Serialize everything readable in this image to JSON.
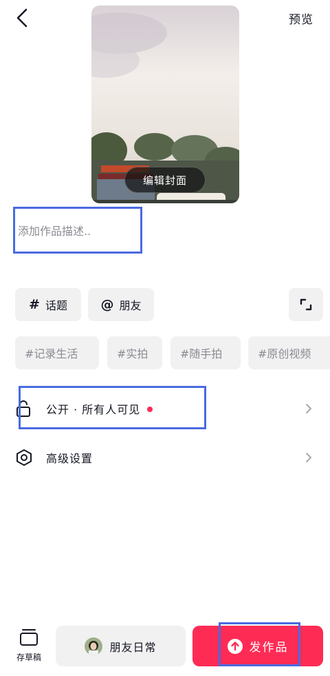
{
  "header": {
    "back_icon": "back-arrow-icon",
    "preview_label": "预览"
  },
  "cover": {
    "edit_label": "编辑封面"
  },
  "description": {
    "placeholder": "添加作品描述.."
  },
  "chips": {
    "topic": {
      "symbol": "#",
      "label": "话题"
    },
    "friends": {
      "symbol": "@",
      "label": "朋友"
    },
    "expand_icon": "expand-corners-icon"
  },
  "hashtags": [
    "#记录生活",
    "#实拍",
    "#随手拍",
    "#原创视频"
  ],
  "settings": {
    "privacy": {
      "label": "公开 · 所有人可见",
      "icon": "unlock-icon"
    },
    "advanced": {
      "label": "高级设置",
      "icon": "hexagon-settings-icon"
    }
  },
  "bottom": {
    "draft_label": "存草稿",
    "daily_label": "朋友日常",
    "publish_label": "发作品"
  },
  "colors": {
    "accent": "#fe2c55",
    "chip_bg": "#f1f1f2",
    "highlight": "#4a6ae0"
  }
}
